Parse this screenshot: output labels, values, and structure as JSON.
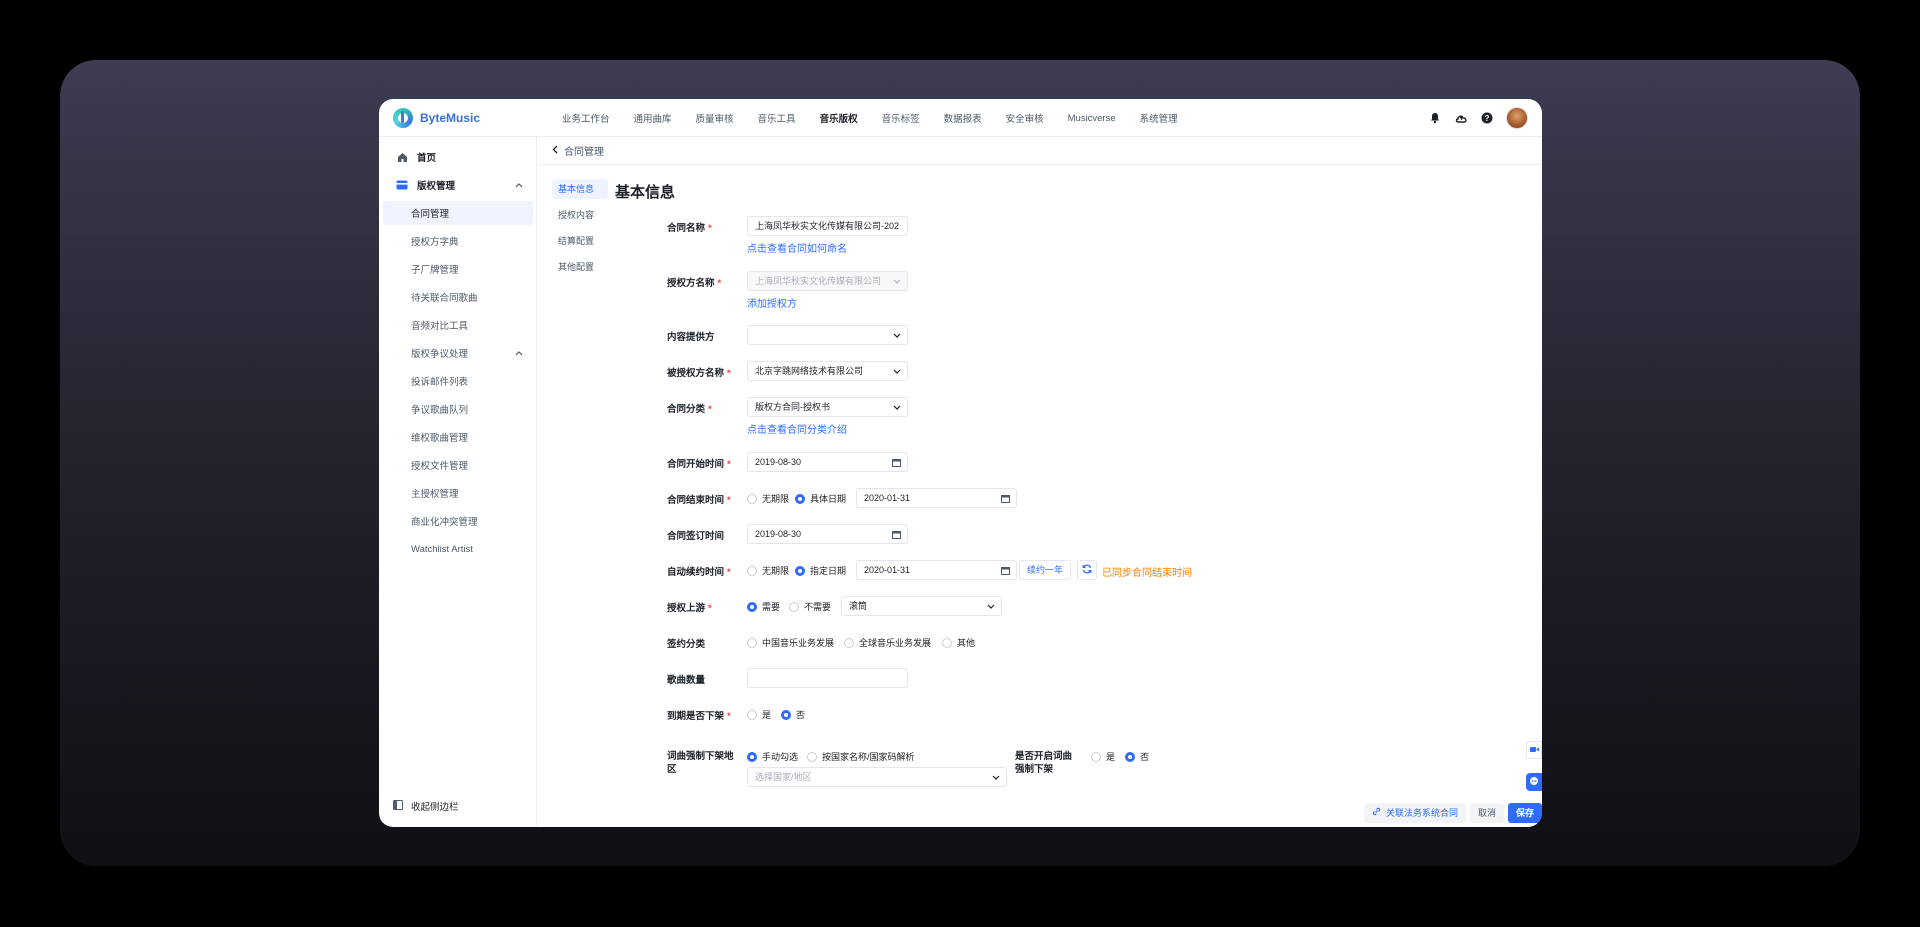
{
  "app": {
    "brand": "ByteMusic"
  },
  "topnav": {
    "items": [
      "业务工作台",
      "通用曲库",
      "质量审核",
      "音乐工具",
      "音乐版权",
      "音乐标签",
      "数据报表",
      "安全审核",
      "Musicverse",
      "系统管理"
    ],
    "active": "音乐版权"
  },
  "sidebar": {
    "home": "首页",
    "group1": "版权管理",
    "items1": [
      "合同管理",
      "授权方字典",
      "子厂牌管理",
      "待关联合同歌曲",
      "音频对比工具"
    ],
    "group2": "版权争议处理",
    "items2": [
      "投诉邮件列表",
      "争议歌曲队列",
      "维权歌曲管理",
      "授权文件管理",
      "主授权管理",
      "商业化冲突管理",
      "Watchlist Artist"
    ],
    "collapse": "收起侧边栏"
  },
  "breadcrumb": {
    "text": "合同管理"
  },
  "anchors": [
    "基本信息",
    "授权内容",
    "结算配置",
    "其他配置"
  ],
  "section_title": "基本信息",
  "form": {
    "contract_name": {
      "label": "合同名称",
      "value": "上海凤华秋实文化传媒有限公司-202",
      "link": "点击查看合同如何命名"
    },
    "licensor": {
      "label": "授权方名称",
      "value": "上海凤华秋实文化传媒有限公司",
      "link": "添加授权方"
    },
    "content_provider": {
      "label": "内容提供方",
      "value": ""
    },
    "licensee": {
      "label": "被授权方名称",
      "value": "北京字跳网络技术有限公司"
    },
    "category": {
      "label": "合同分类",
      "value": "版权方合同-授权书",
      "link": "点击查看合同分类介绍"
    },
    "start_date": {
      "label": "合同开始时间",
      "value": "2019-08-30"
    },
    "end_date": {
      "label": "合同结束时间",
      "opt1": "无期限",
      "opt2": "具体日期",
      "value": "2020-01-31"
    },
    "sign_date": {
      "label": "合同签订时间",
      "value": "2019-08-30"
    },
    "renew_date": {
      "label": "自动续约时间",
      "opt1": "无期限",
      "opt2": "指定日期",
      "value": "2020-01-31",
      "renew_btn": "续约一年",
      "sync_text": "已同步合同结束时间"
    },
    "upstream": {
      "label": "授权上游",
      "opt1": "需要",
      "opt2": "不需要",
      "value": "滚筒"
    },
    "sign_type": {
      "label": "签约分类",
      "opt1": "中国音乐业务发展",
      "opt2": "全球音乐业务发展",
      "opt3": "其他"
    },
    "song_count": {
      "label": "歌曲数量",
      "value": ""
    },
    "expire_takedown": {
      "label": "到期是否下架",
      "opt1": "是",
      "opt2": "否"
    },
    "forced_region": {
      "label": "词曲强制下架地区",
      "opt1": "手动勾选",
      "opt2": "按国家名称/国家码解析",
      "placeholder": "选择国家/地区"
    },
    "forced_takedown": {
      "label": "是否开启词曲强制下架",
      "opt1": "是",
      "opt2": "否"
    }
  },
  "footer": {
    "assoc": "关联法务系统合同",
    "cancel": "取消",
    "save": "保存"
  },
  "colors": {
    "primary": "#2f6bff",
    "warning": "#ff7d00",
    "required": "#f53f3f"
  }
}
